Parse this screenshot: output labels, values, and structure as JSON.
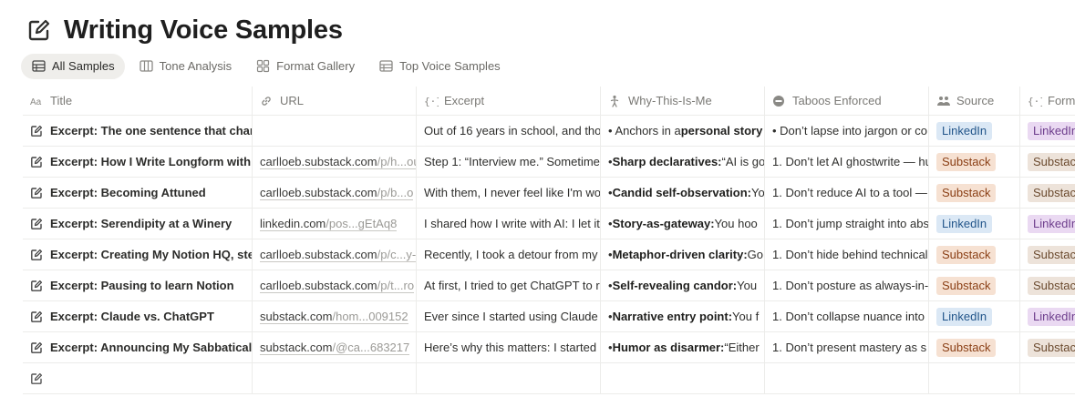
{
  "page": {
    "title": "Writing Voice Samples"
  },
  "tabs": [
    {
      "label": "All Samples",
      "icon": "table-icon"
    },
    {
      "label": "Tone Analysis",
      "icon": "board-icon"
    },
    {
      "label": "Format Gallery",
      "icon": "gallery-icon"
    },
    {
      "label": "Top Voice Samples",
      "icon": "table-icon"
    }
  ],
  "columns": [
    {
      "label": "Title",
      "icon": "text-property-icon"
    },
    {
      "label": "URL",
      "icon": "link-icon"
    },
    {
      "label": "Excerpt",
      "icon": "code-braces-icon"
    },
    {
      "label": "Why-This-Is-Me",
      "icon": "person-icon"
    },
    {
      "label": "Taboos Enforced",
      "icon": "no-entry-icon"
    },
    {
      "label": "Source",
      "icon": "people-icon"
    },
    {
      "label": "Form",
      "icon": "code-braces-icon"
    }
  ],
  "rows": [
    {
      "title": "Excerpt: The one sentence that changed",
      "url_main": "",
      "url_dim": "",
      "excerpt": "Out of 16 years in school, and tho",
      "why_bold": "personal story",
      "why_pre": "• Anchors in a ",
      "why_rest": "",
      "taboo": "• Don’t lapse into jargon or co",
      "source": "LinkedIn",
      "format": "LinkedIn"
    },
    {
      "title": "Excerpt: How I Write Longform with AI",
      "url_main": "carlloeb.substack.com",
      "url_dim": "/p/h...ou",
      "excerpt": "Step 1: “Interview me.” Sometime",
      "why_pre": "• ",
      "why_bold": "Sharp declaratives:",
      "why_rest": " “AI is go",
      "taboo": "1. Don’t let AI ghostwrite — hu",
      "source": "Substack",
      "format": "Substack"
    },
    {
      "title": "Excerpt: Becoming Attuned",
      "url_main": "carlloeb.substack.com",
      "url_dim": "/p/b...o",
      "excerpt": "With them, I never feel like I'm wo",
      "why_pre": "• ",
      "why_bold": "Candid self-observation:",
      "why_rest": " Yo",
      "taboo": "1. Don’t reduce AI to a tool —",
      "source": "Substack",
      "format": "Substack"
    },
    {
      "title": "Excerpt: Serendipity at a Winery",
      "url_main": "linkedin.com",
      "url_dim": "/pos...gEtAq8",
      "excerpt": "I shared how I write with AI: I let it",
      "why_pre": "• ",
      "why_bold": "Story-as-gateway:",
      "why_rest": " You hoo",
      "taboo": "1. Don’t jump straight into abs",
      "source": "LinkedIn",
      "format": "LinkedIn"
    },
    {
      "title": "Excerpt: Creating My Notion HQ, step",
      "url_main": "carlloeb.substack.com",
      "url_dim": "/p/c...y-",
      "excerpt": "Recently, I took a detour from my",
      "why_pre": "• ",
      "why_bold": "Metaphor-driven clarity:",
      "why_rest": " Go",
      "taboo": "1. Don’t hide behind technical",
      "source": "Substack",
      "format": "Substack"
    },
    {
      "title": "Excerpt: Pausing to learn Notion",
      "url_main": "carlloeb.substack.com",
      "url_dim": "/p/t...ro",
      "excerpt": "At first, I tried to get ChatGPT to r",
      "why_pre": "• ",
      "why_bold": "Self-revealing candor:",
      "why_rest": " You",
      "taboo": "1. Don’t posture as always-in-",
      "source": "Substack",
      "format": "Substack"
    },
    {
      "title": "Excerpt: Claude vs. ChatGPT",
      "url_main": "substack.com",
      "url_dim": "/hom...009152",
      "excerpt": "Ever since I started using Claude",
      "why_pre": "• ",
      "why_bold": "Narrative entry point:",
      "why_rest": " You f",
      "taboo": "1. Don’t collapse nuance into",
      "source": "LinkedIn",
      "format": "LinkedIn"
    },
    {
      "title": "Excerpt: Announcing My Sabbatical P",
      "url_main": "substack.com",
      "url_dim": "/@ca...683217",
      "excerpt": "Here’s why this matters: I started",
      "why_pre": "• ",
      "why_bold": "Humor as disarmer:",
      "why_rest": " “Either",
      "taboo": "1. Don’t present mastery as s",
      "source": "Substack",
      "format": "Substack"
    }
  ],
  "colors": {
    "linkedin_bg": "#dbe8f5",
    "substack_bg": "#f6e1d2"
  }
}
